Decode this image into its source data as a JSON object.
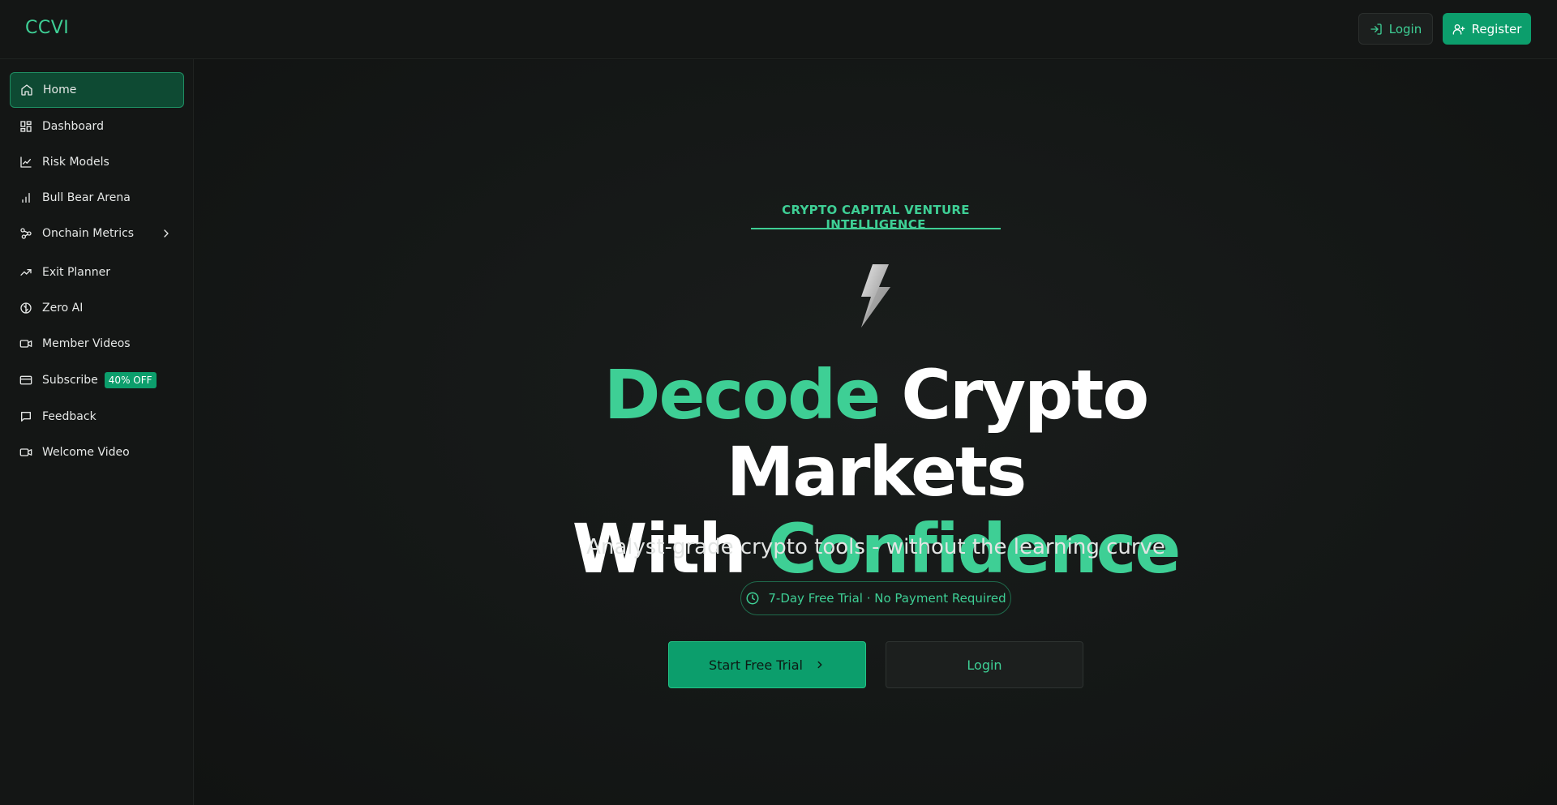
{
  "header": {
    "brand": "CCVI",
    "login_label": "Login",
    "register_label": "Register"
  },
  "sidebar": {
    "items": [
      {
        "label": "Home",
        "icon": "home-icon",
        "active": true
      },
      {
        "label": "Dashboard",
        "icon": "grid-icon"
      },
      {
        "label": "Risk Models",
        "icon": "line-chart-icon"
      },
      {
        "label": "Bull Bear Arena",
        "icon": "bar-chart-icon"
      },
      {
        "label": "Onchain Metrics",
        "icon": "network-icon",
        "expandable": true
      },
      {
        "label": "Exit Planner",
        "icon": "trending-up-icon"
      },
      {
        "label": "Zero AI",
        "icon": "brain-icon"
      },
      {
        "label": "Member Videos",
        "icon": "video-icon"
      },
      {
        "label": "Subscribe",
        "icon": "credit-card-icon",
        "badge": "40% OFF"
      },
      {
        "label": "Feedback",
        "icon": "message-icon"
      },
      {
        "label": "Welcome Video",
        "icon": "video-icon"
      }
    ]
  },
  "hero": {
    "eyebrow": "CRYPTO CAPITAL VENTURE INTELLIGENCE",
    "headline_accent_1": "Decode",
    "headline_rest_1": " Crypto Markets",
    "headline_rest_2": "With ",
    "headline_accent_2": "Confidence",
    "subline": "Analyst-grade crypto tools - without the learning curve",
    "trial_note": "7-Day Free Trial · No Payment Required",
    "cta_primary": "Start Free Trial",
    "cta_secondary": "Login"
  },
  "colors": {
    "accent": "#3ecf95",
    "button_green": "#0c9e6c",
    "background": "#121413"
  }
}
